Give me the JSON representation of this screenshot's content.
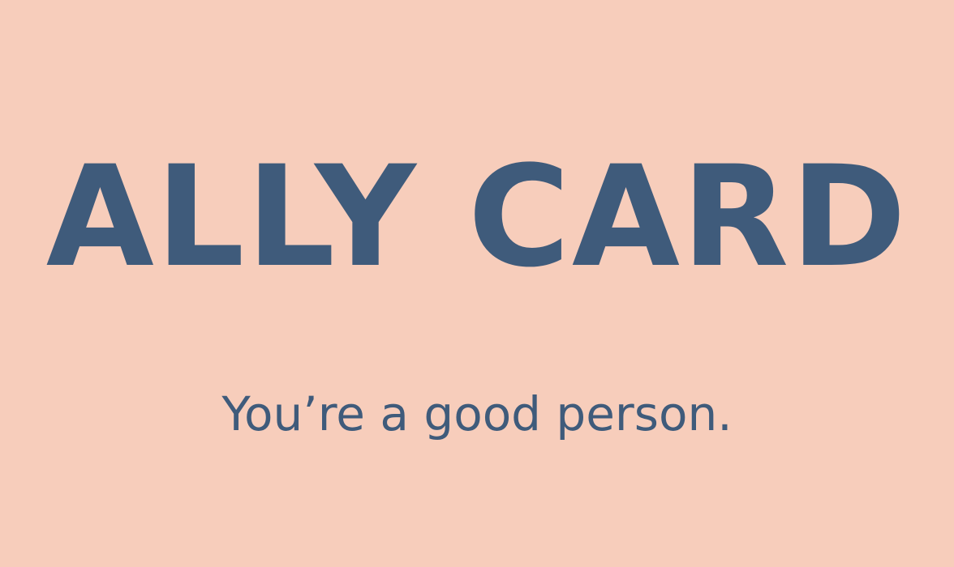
{
  "card": {
    "title": "ALLY CARD",
    "tagline": "You’re a good person.",
    "background_color": "#f7cdbb",
    "text_color": "#3f5b7b"
  }
}
